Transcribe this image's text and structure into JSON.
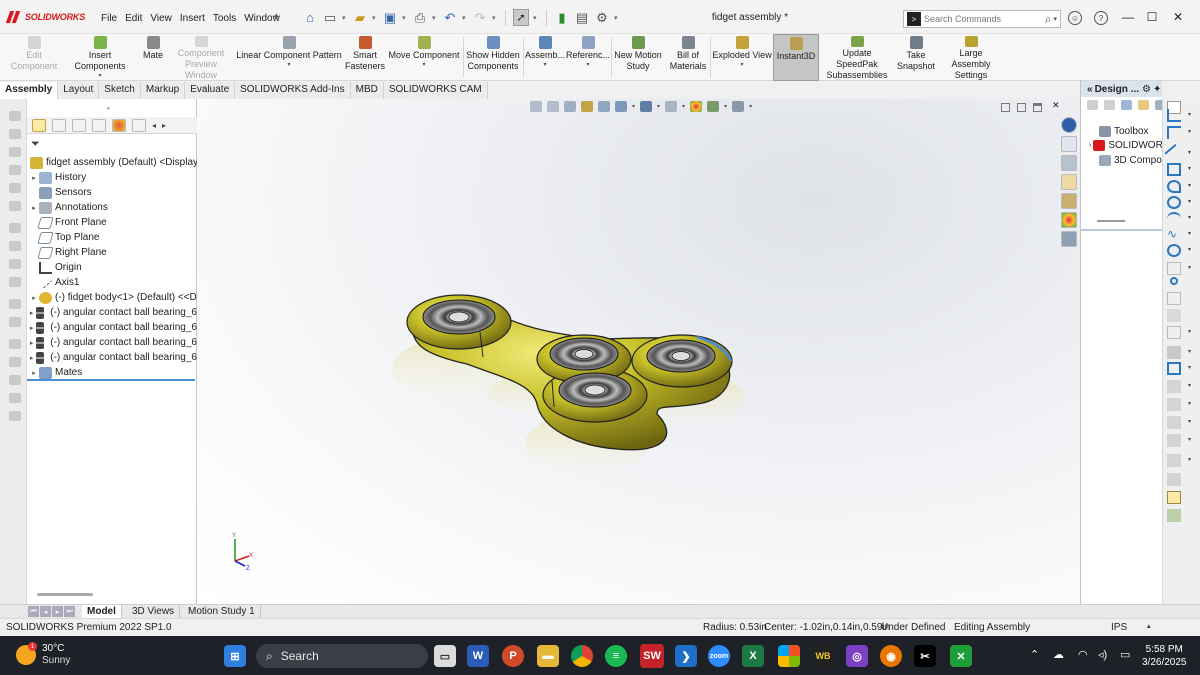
{
  "titlebar": {
    "logo": "SOLIDWORKS",
    "menus": [
      "File",
      "Edit",
      "View",
      "Insert",
      "Tools",
      "Window"
    ],
    "document_title": "fidget assembly *",
    "search_placeholder": "Search Commands"
  },
  "ribbon": {
    "buttons": [
      {
        "label": "Edit\nComponent",
        "enabled": false
      },
      {
        "label": "Insert Components",
        "enabled": true
      },
      {
        "label": "Mate",
        "enabled": true
      },
      {
        "label": "Component\nPreview Window",
        "enabled": false
      },
      {
        "label": "Linear Component Pattern",
        "enabled": true
      },
      {
        "label": "Smart\nFasteners",
        "enabled": true
      },
      {
        "label": "Move Component",
        "enabled": true
      },
      {
        "label": "Show Hidden\nComponents",
        "enabled": true
      },
      {
        "label": "Assemb...",
        "enabled": true
      },
      {
        "label": "Referenc...",
        "enabled": true
      },
      {
        "label": "New Motion\nStudy",
        "enabled": true
      },
      {
        "label": "Bill of\nMaterials",
        "enabled": true
      },
      {
        "label": "Exploded View",
        "enabled": true
      },
      {
        "label": "Instant3D",
        "enabled": true,
        "selected": true
      },
      {
        "label": "Update SpeedPak\nSubassemblies",
        "enabled": true
      },
      {
        "label": "Take\nSnapshot",
        "enabled": true
      },
      {
        "label": "Large Assembly\nSettings",
        "enabled": true
      }
    ]
  },
  "command_tabs": [
    "Assembly",
    "Layout",
    "Sketch",
    "Markup",
    "Evaluate",
    "SOLIDWORKS Add-Ins",
    "MBD",
    "SOLIDWORKS CAM"
  ],
  "feature_tree": {
    "root": "fidget assembly (Default) <Display S",
    "items": [
      {
        "label": "History",
        "expandable": true
      },
      {
        "label": "Sensors",
        "expandable": false
      },
      {
        "label": "Annotations",
        "expandable": true
      },
      {
        "label": "Front Plane",
        "expandable": false
      },
      {
        "label": "Top Plane",
        "expandable": false
      },
      {
        "label": "Right Plane",
        "expandable": false
      },
      {
        "label": "Origin",
        "expandable": false
      },
      {
        "label": "Axis1",
        "expandable": false
      },
      {
        "label": "(-) fidget body<1> (Default) <<D",
        "expandable": true
      },
      {
        "label": "(-) angular contact ball bearing_6",
        "expandable": true
      },
      {
        "label": "(-) angular contact ball bearing_6",
        "expandable": true
      },
      {
        "label": "(-) angular contact ball bearing_6",
        "expandable": true
      },
      {
        "label": "(-) angular contact ball bearing_6",
        "expandable": true
      },
      {
        "label": "Mates",
        "expandable": true
      }
    ]
  },
  "bottom_tabs": [
    "Model",
    "3D Views",
    "Motion Study 1"
  ],
  "status_bar": {
    "product": "SOLIDWORKS Premium 2022 SP1.0",
    "radius": "Radius: 0.53in",
    "center": "Center: -1.02in,0.14in,0.59in",
    "definition": "Under Defined",
    "mode": "Editing Assembly",
    "units": "IPS"
  },
  "design_library": {
    "title": "Design ...",
    "items": [
      "Toolbox",
      "SOLIDWORK",
      "3D Compon"
    ]
  },
  "triad": {
    "y": "Y",
    "x": "X",
    "z": "Z"
  },
  "taskbar": {
    "temperature": "30°C",
    "condition": "Sunny",
    "weather_badge": "1",
    "search": "Search",
    "time": "5:58 PM",
    "date": "3/26/2025"
  },
  "colors": {
    "model_body": "#c9c22a",
    "accent": "#d7191f",
    "tree_selection_line": "#4b8fd6"
  }
}
